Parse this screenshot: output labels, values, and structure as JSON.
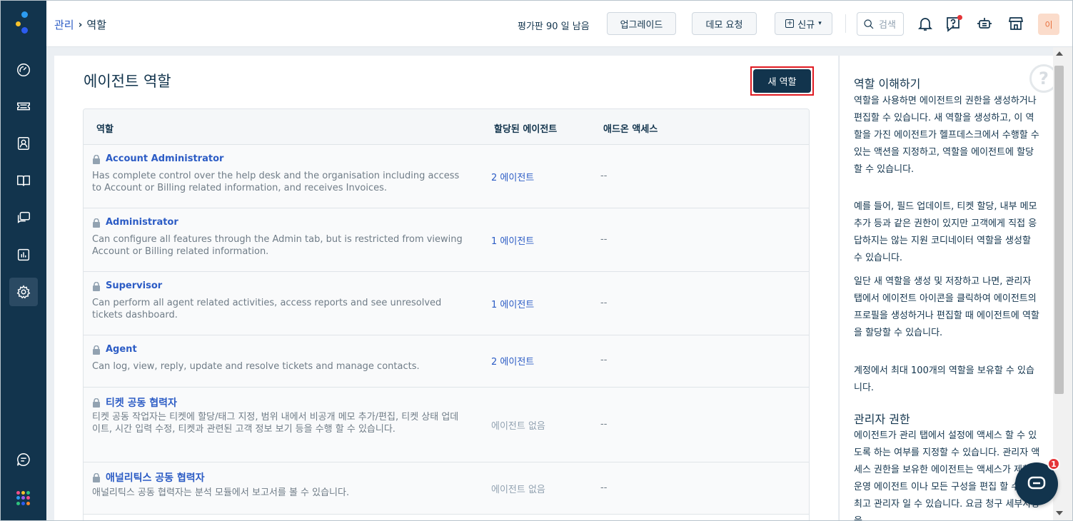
{
  "breadcrumb": {
    "parent": "관리",
    "current": "역할"
  },
  "topbar": {
    "trial": "평가판 90 일 남음",
    "upgrade": "업그레이드",
    "demo": "데모 요청",
    "new": "신규",
    "search_placeholder": "검색",
    "avatar": "이"
  },
  "main": {
    "title": "에이전트 역할",
    "new_role": "새 역할"
  },
  "table": {
    "headers": {
      "role": "역할",
      "assigned": "할당된 에이전트",
      "addon": "애드온 액세스"
    },
    "rows": [
      {
        "name": "Account Administrator",
        "desc": "Has complete control over the help desk and the organisation including access to Account or Billing related information, and receives Invoices.",
        "agents": "2 에이전트",
        "addon": "--"
      },
      {
        "name": "Administrator",
        "desc": "Can configure all features through the Admin tab, but is restricted from viewing Account or Billing related information.",
        "agents": "1 에이전트",
        "addon": "--"
      },
      {
        "name": "Supervisor",
        "desc": "Can perform all agent related activities, access reports and see unresolved tickets dashboard.",
        "agents": "1 에이전트",
        "addon": "--"
      },
      {
        "name": "Agent",
        "desc": "Can log, view, reply, update and resolve tickets and manage contacts.",
        "agents": "2 에이전트",
        "addon": "--"
      },
      {
        "name": "티켓 공동 협력자",
        "desc": "티켓 공동 작업자는 티켓에 할당/태그 지정, 범위 내에서 비공개 메모 추가/편집, 티켓 상태 업데이트, 시간 입력 수정, 티켓과 관련된 고객 정보 보기 등을 수행 할 수 있습니다.",
        "agents": "에이전트 없음",
        "addon": "--"
      },
      {
        "name": "애널리틱스 공동 협력자",
        "desc": "애널리틱스 공동 협력자는 분석 모듈에서 보고서를 볼 수 있습니다.",
        "agents": "에이전트 없음",
        "addon": "--"
      }
    ]
  },
  "help": {
    "h1": "역할 이해하기",
    "p1": "역할을 사용하면 에이전트의 권한을 생성하거나 편집할 수 있습니다. 새 역할을 생성하고, 이 역할을 가진 에이전트가 헬프데스크에서 수행할 수 있는 액션을 지정하고, 역할을 에이전트에 할당할 수 있습니다.",
    "p2": "예를 들어, 필드 업데이트, 티켓 할당, 내부 메모 추가 등과 같은 권한이 있지만 고객에게 직접 응답하지는 않는 지원 코디네이터 역할을 생성할 수 있습니다.",
    "p3": "일단 새 역할을 생성 및 저장하고 나면, 관리자 탭에서 에이전트 아이콘을 클릭하여 에이전트의 프로필을 생성하거나 편집할 때 에이전트에 역할을 할당할 수 있습니다.",
    "p4": "계정에서 최대 100개의 역할을 보유할 수 있습니다.",
    "h2": "관리자 권한",
    "p5": "에이전트가 관리 탭에서 설정에 액세스 할 수 있도록 하는 여부를 지정할 수 있습니다. 관리자 액세스 권한을 보유한 에이전트는 액세스가 제한된 운영 에이전트 이나 모든 구성을 편집 할 수 있는 최고 관리자 일 수 있습니다. 요금 청구 세부사항을"
  },
  "chat": {
    "badge": "1"
  },
  "colors": {
    "sidebar": "#12344d",
    "accent": "#2c5cc5",
    "highlight": "#e01b22"
  }
}
